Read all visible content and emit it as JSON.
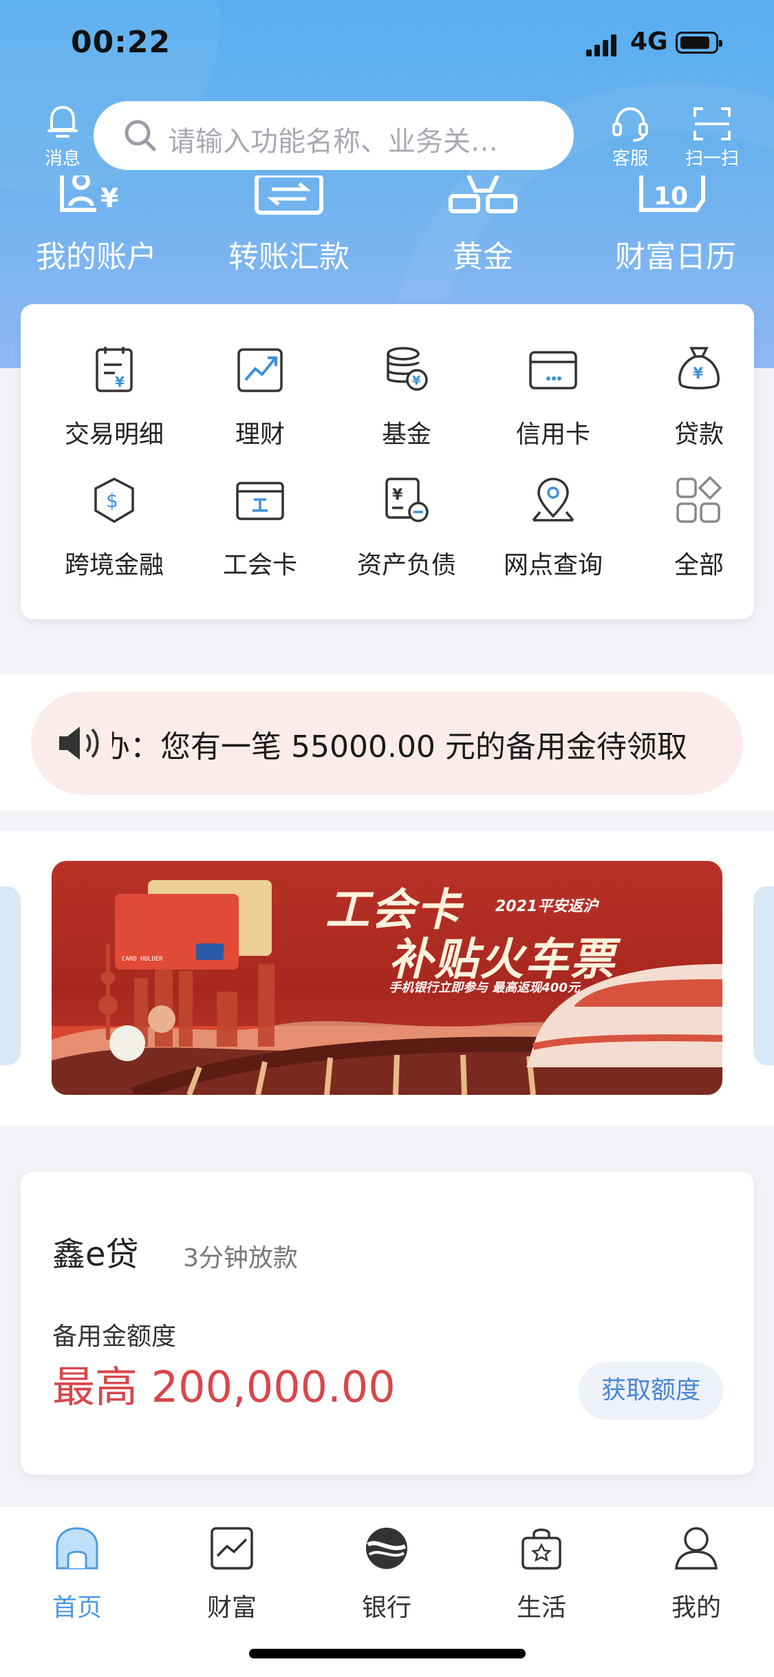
{
  "status": {
    "time": "00:22",
    "network": "4G"
  },
  "header": {
    "message_label": "消息",
    "search_placeholder": "请输入功能名称、业务关…",
    "service_label": "客服",
    "scan_label": "扫一扫"
  },
  "quick_actions": [
    {
      "label": "我的账户",
      "icon": "account-yuan-icon"
    },
    {
      "label": "转账汇款",
      "icon": "transfer-icon"
    },
    {
      "label": "黄金",
      "icon": "gold-bars-icon"
    },
    {
      "label": "财富日历",
      "icon": "calendar-10-icon"
    }
  ],
  "services": [
    {
      "label": "交易明细",
      "icon": "transaction-detail-icon"
    },
    {
      "label": "理财",
      "icon": "wealth-chart-icon"
    },
    {
      "label": "基金",
      "icon": "fund-icon"
    },
    {
      "label": "信用卡",
      "icon": "credit-card-icon"
    },
    {
      "label": "贷款",
      "icon": "loan-bag-icon"
    },
    {
      "label": "跨境金融",
      "icon": "cross-border-icon"
    },
    {
      "label": "工会卡",
      "icon": "union-card-icon"
    },
    {
      "label": "资产负债",
      "icon": "assets-liabilities-icon"
    },
    {
      "label": "网点查询",
      "icon": "location-pin-icon"
    },
    {
      "label": "全部",
      "icon": "all-grid-icon"
    }
  ],
  "notice": {
    "text": "办：您有一笔 55000.00 元的备用金待领取",
    "icon": "speaker-icon"
  },
  "banner": {
    "title_line1": "工会卡",
    "title_line2": "补贴火车票",
    "badge": "2021平安返沪",
    "subtitle": "手机银行立即参与 最高返现400元",
    "card_text": "CARD HOLDER"
  },
  "loan": {
    "product": "鑫e贷",
    "tagline": "3分钟放款",
    "limit_label": "备用金额度",
    "amount": "最高 200,000.00",
    "button": "获取额度",
    "accent": "#d8474a"
  },
  "tabs": [
    {
      "label": "首页",
      "active": true,
      "icon": "home-icon"
    },
    {
      "label": "财富",
      "active": false,
      "icon": "wealth-icon"
    },
    {
      "label": "银行",
      "active": false,
      "icon": "bank-logo-icon"
    },
    {
      "label": "生活",
      "active": false,
      "icon": "shopping-bag-icon"
    },
    {
      "label": "我的",
      "active": false,
      "icon": "profile-icon"
    }
  ],
  "colors": {
    "primary_blue": "#5aa8ee",
    "active_tab": "#4a9ae6",
    "icon_blue": "#3f8fd9"
  }
}
